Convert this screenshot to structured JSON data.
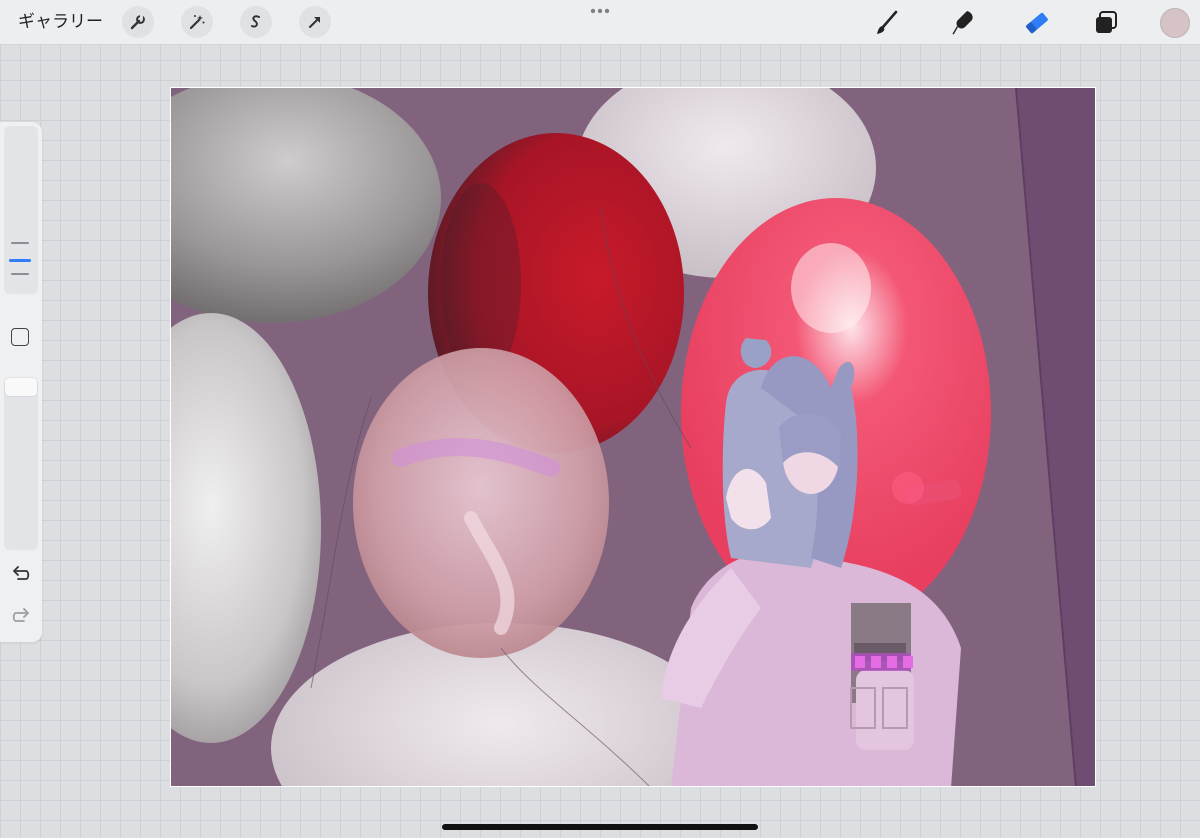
{
  "toolbar": {
    "gallery_label": "ギャラリー",
    "left_tools": [
      "wrench-icon",
      "magic-wand-icon",
      "selection-icon",
      "transform-arrow-icon"
    ],
    "right_tools": [
      "brush-icon",
      "smudge-icon",
      "eraser-icon",
      "layers-icon"
    ],
    "active_tool": "eraser",
    "current_color": "#d5c3c6",
    "accent_color": "#2f7df6"
  },
  "sidebar": {
    "controls": [
      "brush-size-slider",
      "modify-button",
      "opacity-slider",
      "undo-button",
      "redo-button"
    ]
  },
  "canvas": {
    "background_color": "#82637e",
    "subject": "balloons-illustration"
  }
}
